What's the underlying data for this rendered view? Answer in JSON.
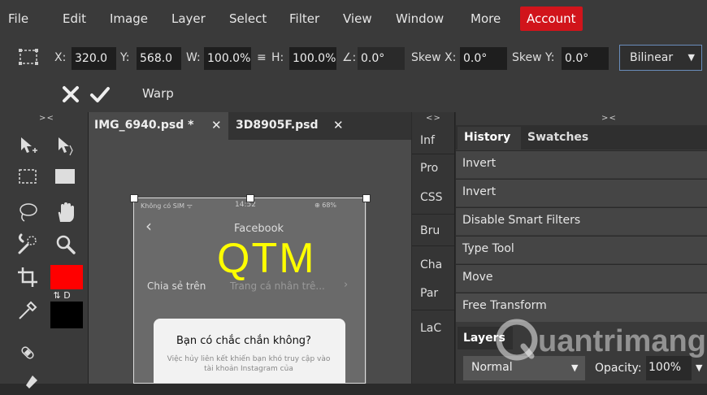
{
  "menubar": {
    "items": [
      "File",
      "Edit",
      "Image",
      "Layer",
      "Select",
      "Filter",
      "View",
      "Window",
      "More",
      "Account"
    ]
  },
  "options": {
    "x_label": "X:",
    "x_value": "320.0",
    "y_label": "Y:",
    "y_value": "568.0",
    "w_label": "W:",
    "w_value": "100.0%",
    "link_symbol": "≡",
    "h_label": "H:",
    "h_value": "100.0%",
    "angle_symbol": "∠:",
    "angle_value": "0.0°",
    "skewx_label": "Skew X:",
    "skewx_value": "0.0°",
    "skewy_label": "Skew Y:",
    "skewy_value": "0.0°",
    "interpolation": "Bilinear"
  },
  "warp": {
    "label": "Warp"
  },
  "tabs": [
    {
      "label": "IMG_6940.psd *"
    },
    {
      "label": "3D8905F.psd"
    }
  ],
  "collapse": {
    "left": "> <",
    "mini": "< >",
    "right": "> <"
  },
  "mini_panel": [
    "Inf",
    "Pro",
    "CSS",
    "Bru",
    "Cha",
    "Par",
    "LaC"
  ],
  "panel_tabs": {
    "history": "History",
    "swatches": "Swatches"
  },
  "history": [
    "Invert",
    "Invert",
    "Disable Smart Filters",
    "Type Tool",
    "Move",
    "Free Transform"
  ],
  "layers": {
    "title": "Layers",
    "blend_mode": "Normal",
    "opacity_label": "Opacity:",
    "opacity_value": "100%"
  },
  "phone": {
    "status_carrier": "Không có SIM ᯤ",
    "status_time": "14:52",
    "status_battery": "⊕ 68%",
    "header": "Facebook",
    "overlay_text": "QTM",
    "share_label": "Chia sẻ trên",
    "share_target": "Trang cá nhân trê...",
    "dialog_title": "Bạn có chắc chắn không?",
    "dialog_body": "Việc hủy liên kết khiến bạn khó truy cập vào tài khoản Instagram của"
  },
  "colors": {
    "foreground": "#ff0000",
    "background": "#000000",
    "account_bg": "#d1141b",
    "overlay_text": "#ffff00"
  },
  "watermark": "uantrimang",
  "icons": [
    "cross-icon",
    "check-icon",
    "transform-box-icon",
    "move-tool-icon",
    "select-tool-icon",
    "marquee-tool-icon",
    "rectangle-tool-icon",
    "lasso-tool-icon",
    "hand-tool-icon",
    "quick-select-tool-icon",
    "zoom-tool-icon",
    "crop-tool-icon",
    "eyedropper-tool-icon",
    "healing-tool-icon",
    "brush-tool-icon"
  ]
}
